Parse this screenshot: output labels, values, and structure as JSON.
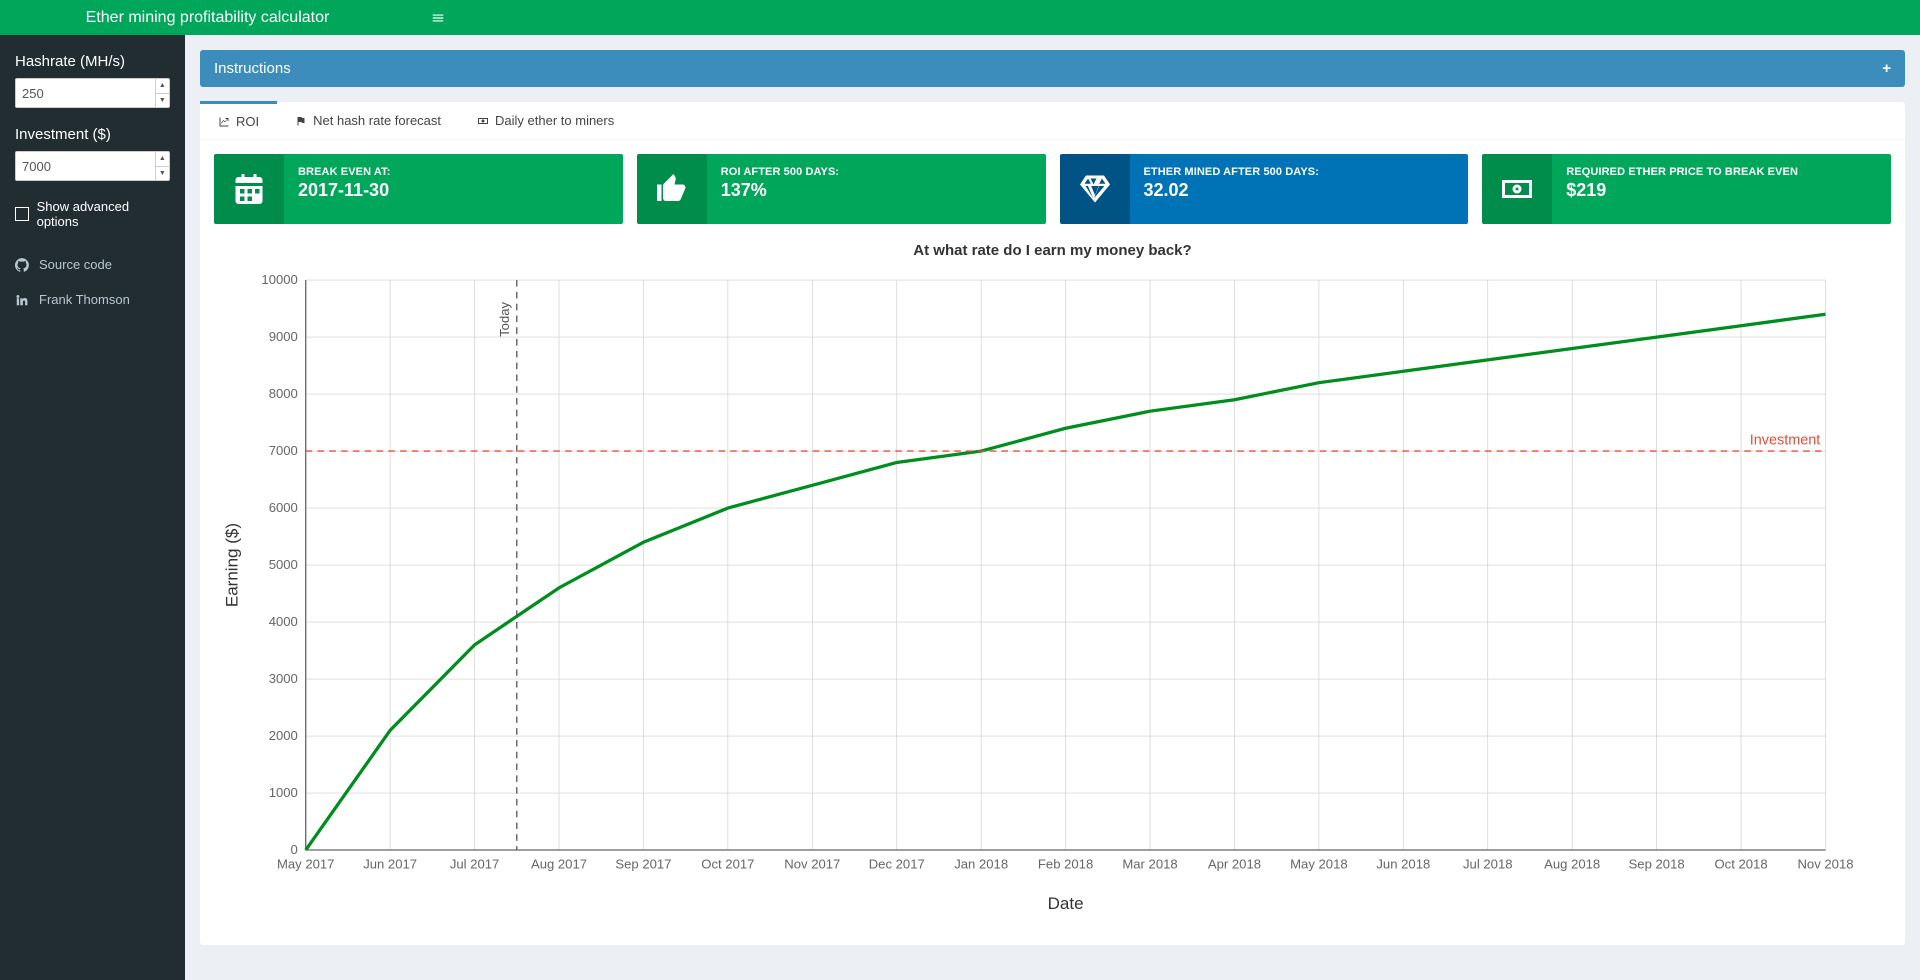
{
  "header": {
    "title": "Ether mining profitability calculator"
  },
  "sidebar": {
    "hashrate_label": "Hashrate (MH/s)",
    "hashrate_value": "250",
    "investment_label": "Investment ($)",
    "investment_value": "7000",
    "advanced_label": "Show advanced options",
    "links": {
      "source": "Source code",
      "author": "Frank Thomson"
    }
  },
  "instructions": {
    "title": "Instructions"
  },
  "tabs": {
    "roi": "ROI",
    "forecast": "Net hash rate forecast",
    "daily": "Daily ether to miners"
  },
  "cards": {
    "breakeven": {
      "title": "BREAK EVEN AT:",
      "value": "2017-11-30"
    },
    "roi": {
      "title": "ROI AFTER 500 DAYS:",
      "value": "137%"
    },
    "mined": {
      "title": "ETHER MINED AFTER 500 DAYS:",
      "value": "32.02"
    },
    "reqprice": {
      "title": "REQUIRED ETHER PRICE TO BREAK EVEN",
      "value": "$219"
    }
  },
  "chart_data": {
    "type": "line",
    "title": "At what rate do I earn my money back?",
    "xlabel": "Date",
    "ylabel": "Earning ($)",
    "ylim": [
      0,
      10000
    ],
    "categories": [
      "May 2017",
      "Jun 2017",
      "Jul 2017",
      "Aug 2017",
      "Sep 2017",
      "Oct 2017",
      "Nov 2017",
      "Dec 2017",
      "Jan 2018",
      "Feb 2018",
      "Mar 2018",
      "Apr 2018",
      "May 2018",
      "Jun 2018",
      "Jul 2018",
      "Aug 2018",
      "Sep 2018",
      "Oct 2018",
      "Nov 2018"
    ],
    "values": [
      0,
      2100,
      3600,
      4600,
      5400,
      6000,
      6400,
      6800,
      7000,
      7400,
      7700,
      7900,
      8200,
      8400,
      8600,
      8800,
      9000,
      9200,
      9400
    ],
    "today_index": 2.5,
    "investment_line": {
      "value": 7000,
      "label": "Investment"
    }
  }
}
